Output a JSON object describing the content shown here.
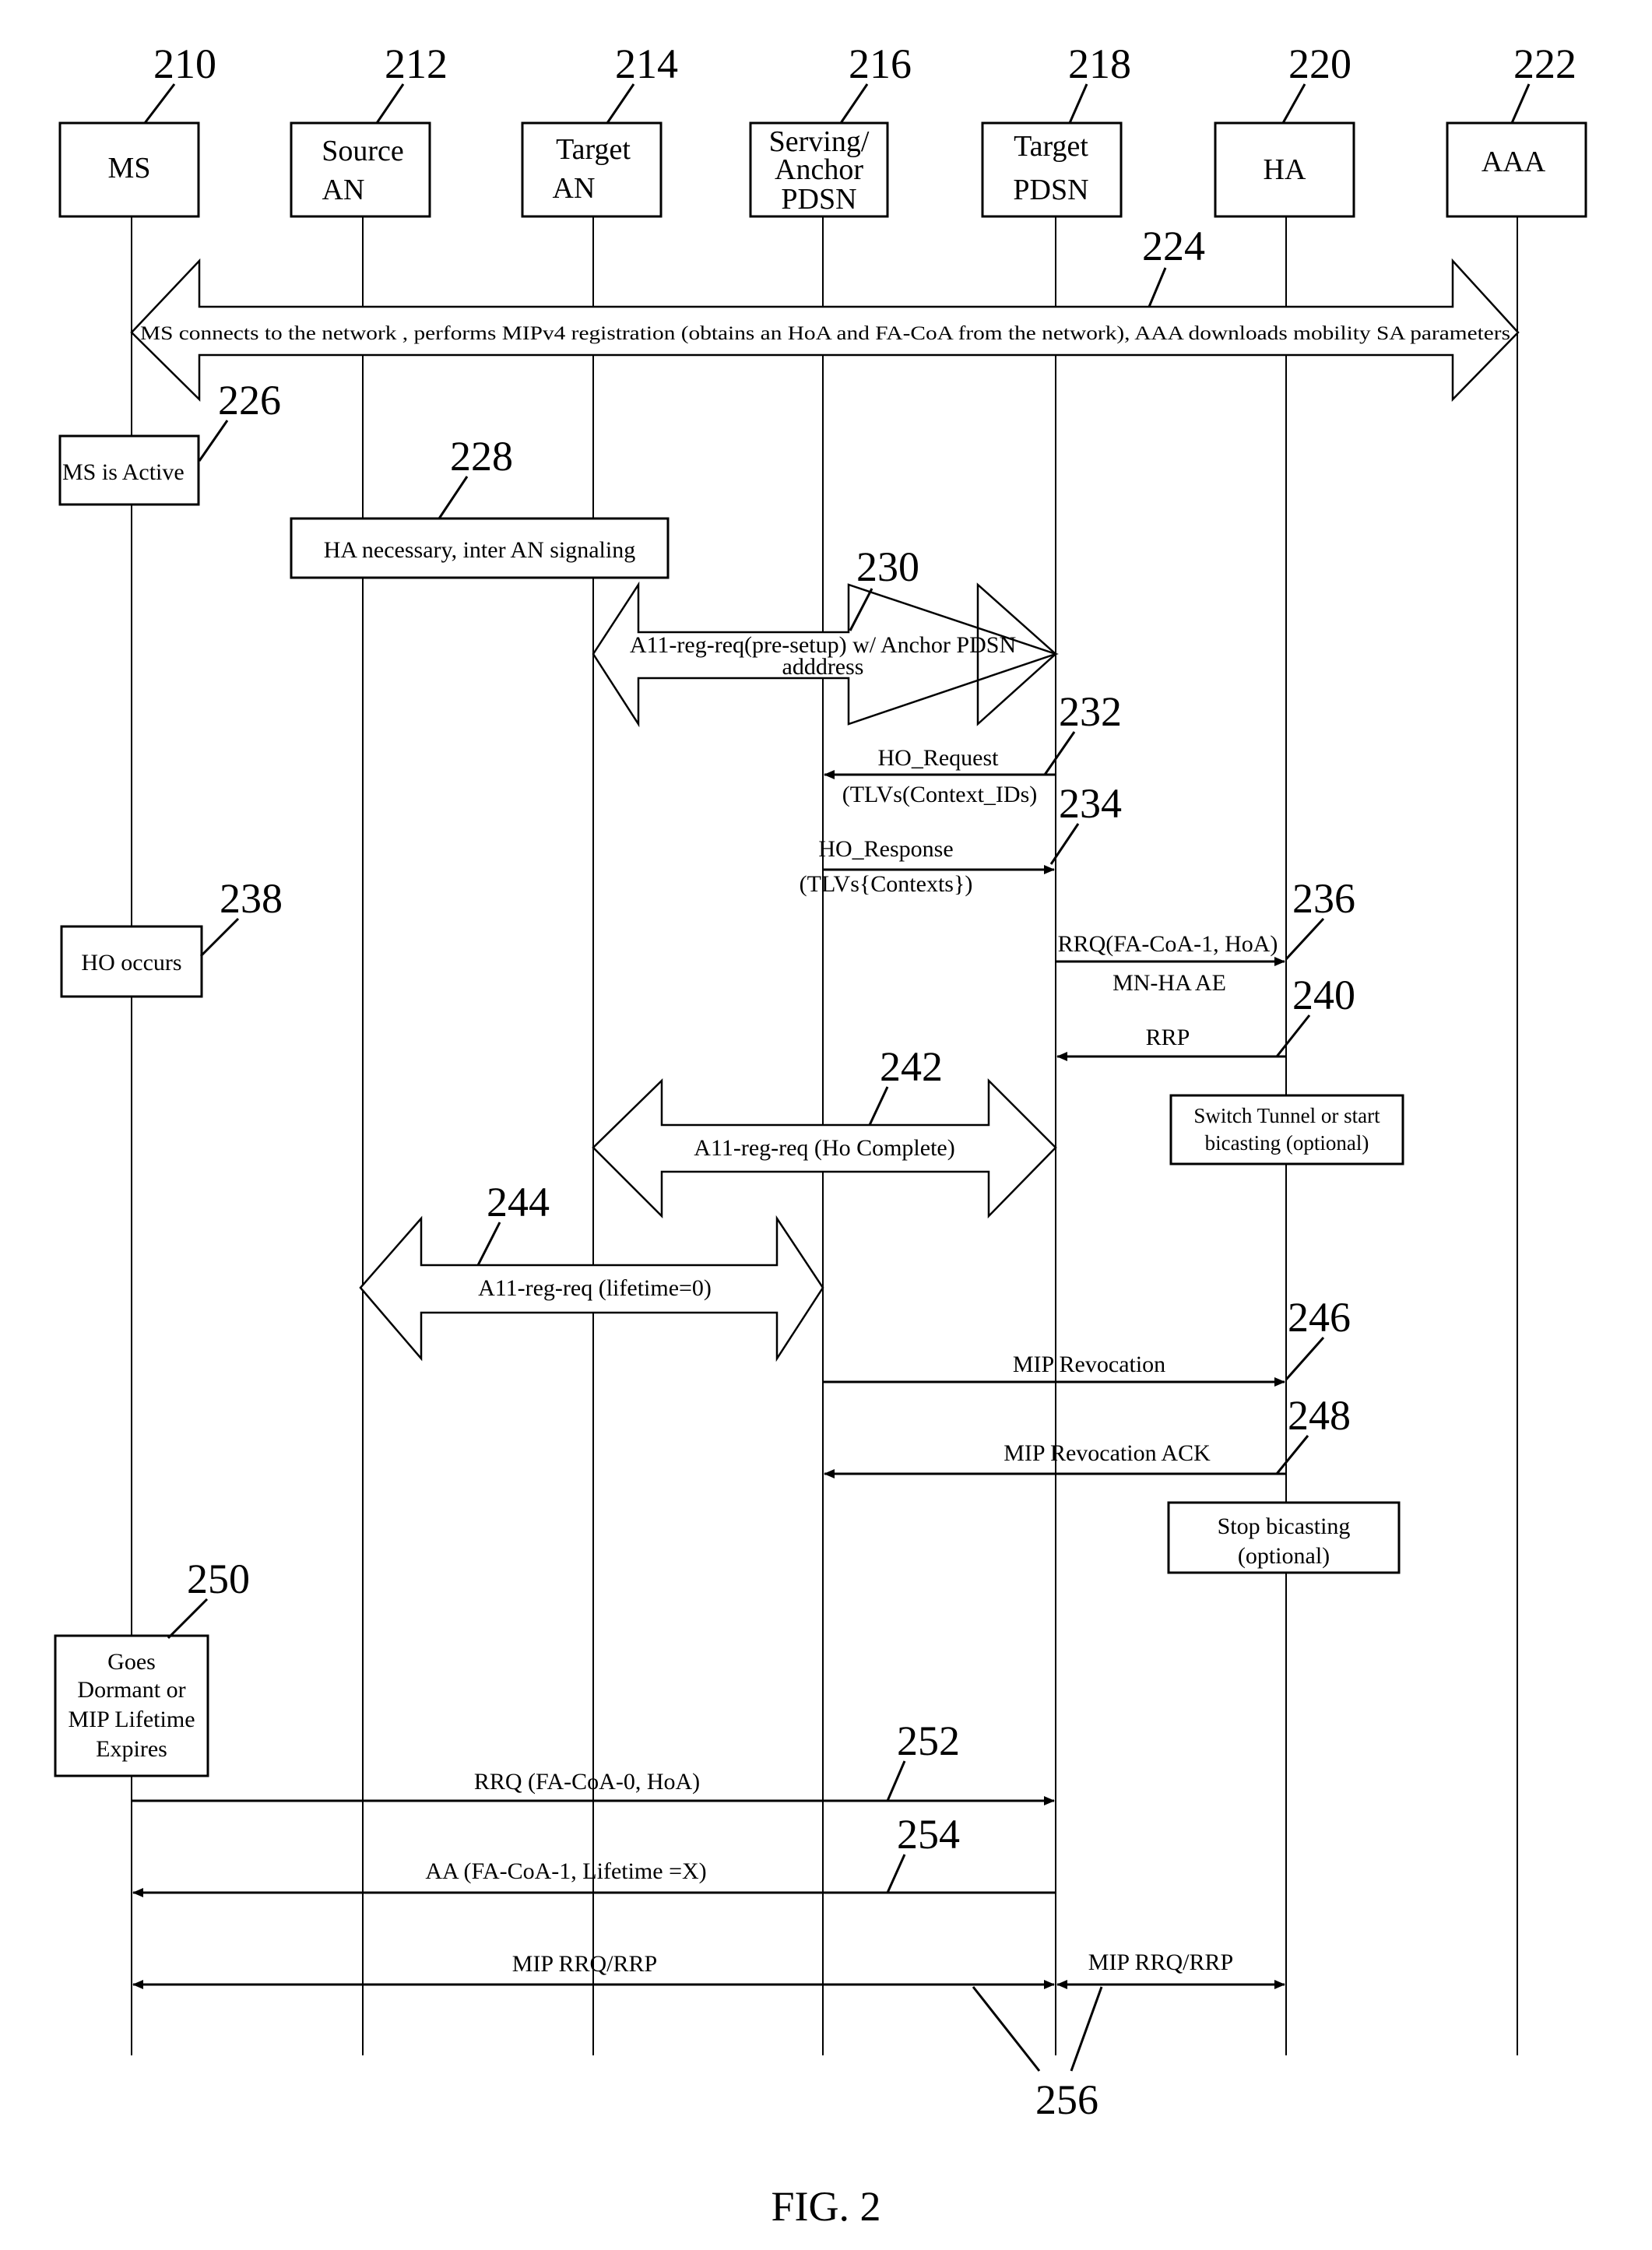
{
  "figure": {
    "caption": "FIG. 2",
    "type": "call-flow sequence diagram"
  },
  "entities": [
    {
      "ref": "210",
      "lines": [
        "MS"
      ]
    },
    {
      "ref": "212",
      "lines": [
        "Source",
        "AN"
      ]
    },
    {
      "ref": "214",
      "lines": [
        "Target",
        "AN"
      ]
    },
    {
      "ref": "216",
      "lines": [
        "Serving/",
        "Anchor",
        "PDSN"
      ]
    },
    {
      "ref": "218",
      "lines": [
        "Target",
        "PDSN"
      ]
    },
    {
      "ref": "220",
      "lines": [
        "HA"
      ]
    },
    {
      "ref": "222",
      "lines": [
        "AAA"
      ]
    }
  ],
  "steps": {
    "s224": {
      "ref": "224",
      "from": "MS",
      "to": "AAA",
      "kind": "bidirectional-block",
      "lines": [
        "MS connects to the network , performs MIPv4 registration (obtains an HoA and FA-CoA from the network), AAA downloads mobility SA parameters"
      ]
    },
    "s226": {
      "ref": "226",
      "kind": "note",
      "on": "MS",
      "lines": [
        "MS is Active"
      ]
    },
    "s228": {
      "ref": "228",
      "kind": "note",
      "on": "Source AN / Target AN",
      "lines": [
        "HA necessary, inter AN signaling"
      ]
    },
    "s230": {
      "ref": "230",
      "from": "Target AN",
      "to": "Target PDSN",
      "kind": "bidirectional-block",
      "lines": [
        "A11-reg-req(pre-setup) w/ Anchor PDSN",
        "adddress"
      ]
    },
    "s232": {
      "ref": "232",
      "from": "Target PDSN",
      "to": "Serving/Anchor PDSN",
      "kind": "message",
      "lines": [
        "HO_Request",
        "(TLVs(Context_IDs)"
      ]
    },
    "s234": {
      "ref": "234",
      "from": "Serving/Anchor PDSN",
      "to": "Target PDSN",
      "kind": "message",
      "lines": [
        "HO_Response",
        "(TLVs{Contexts})"
      ]
    },
    "s238": {
      "ref": "238",
      "kind": "note",
      "on": "MS",
      "lines": [
        "HO occurs"
      ]
    },
    "s236": {
      "ref": "236",
      "from": "Target PDSN",
      "to": "HA",
      "kind": "message",
      "lines": [
        "RRQ(FA-CoA-1, HoA)",
        "MN-HA AE"
      ]
    },
    "s240": {
      "ref": "240",
      "from": "HA",
      "to": "Target PDSN",
      "kind": "message",
      "lines": [
        "RRP"
      ]
    },
    "switch_note": {
      "kind": "note",
      "on": "HA",
      "lines": [
        "Switch Tunnel or start",
        "bicasting (optional)"
      ]
    },
    "s242": {
      "ref": "242",
      "from": "Target AN",
      "to": "Target PDSN",
      "kind": "bidirectional-block",
      "lines": [
        "A11-reg-req (Ho Complete)"
      ]
    },
    "s244": {
      "ref": "244",
      "from": "Source AN",
      "to": "Serving/Anchor PDSN",
      "kind": "bidirectional-block",
      "lines": [
        "A11-reg-req (lifetime=0)"
      ]
    },
    "s246": {
      "ref": "246",
      "from": "Serving/Anchor PDSN",
      "to": "HA",
      "kind": "message",
      "lines": [
        "MIP Revocation"
      ]
    },
    "s248": {
      "ref": "248",
      "from": "HA",
      "to": "Serving/Anchor PDSN",
      "kind": "message",
      "lines": [
        "MIP Revocation ACK"
      ]
    },
    "stop_note": {
      "kind": "note",
      "on": "HA",
      "lines": [
        "Stop bicasting",
        "(optional)"
      ]
    },
    "s250": {
      "ref": "250",
      "kind": "note",
      "on": "MS",
      "lines": [
        "Goes",
        "Dormant or",
        "MIP Lifetime",
        "Expires"
      ]
    },
    "s252": {
      "ref": "252",
      "from": "MS",
      "to": "Target PDSN",
      "kind": "message",
      "lines": [
        "RRQ (FA-CoA-0, HoA)"
      ]
    },
    "s254": {
      "ref": "254",
      "from": "Target PDSN",
      "to": "MS",
      "kind": "message",
      "lines": [
        "AA (FA-CoA-1, Lifetime =X)"
      ]
    },
    "s256a": {
      "ref": "256",
      "from": "MS",
      "to": "Target PDSN",
      "kind": "bidirectional-message",
      "lines": [
        "MIP RRQ/RRP"
      ]
    },
    "s256b": {
      "ref": "256",
      "from": "Target PDSN",
      "to": "HA",
      "kind": "bidirectional-message",
      "lines": [
        "MIP RRQ/RRP"
      ]
    }
  }
}
